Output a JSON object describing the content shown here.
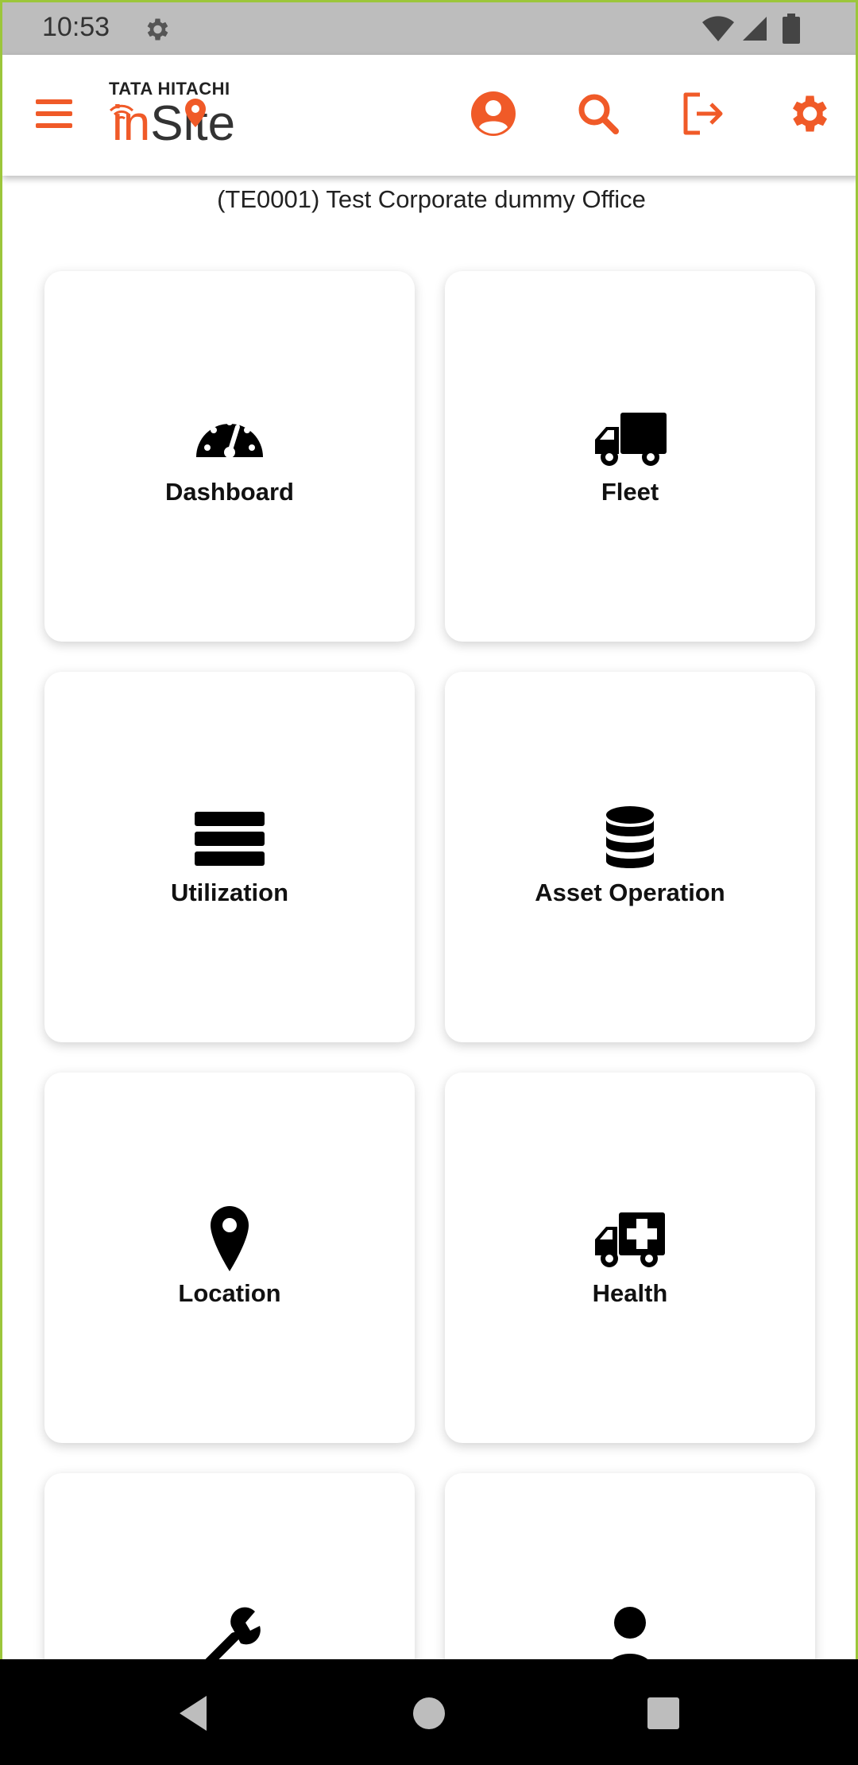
{
  "status_bar": {
    "time": "10:53"
  },
  "header": {
    "logo_top": "TATA HITACHI",
    "logo_main_prefix": "in",
    "logo_main_suffix": "Site",
    "accent_color": "#f05a28"
  },
  "subtitle": "(TE0001) Test Corporate dummy Office",
  "tiles": [
    {
      "label": "Dashboard",
      "icon": "gauge-icon"
    },
    {
      "label": "Fleet",
      "icon": "truck-icon"
    },
    {
      "label": "Utilization",
      "icon": "bars-icon"
    },
    {
      "label": "Asset Operation",
      "icon": "database-icon"
    },
    {
      "label": "Location",
      "icon": "map-pin-icon"
    },
    {
      "label": "Health",
      "icon": "ambulance-icon"
    },
    {
      "label": "",
      "icon": "wrench-icon"
    },
    {
      "label": "",
      "icon": "user-icon"
    }
  ]
}
